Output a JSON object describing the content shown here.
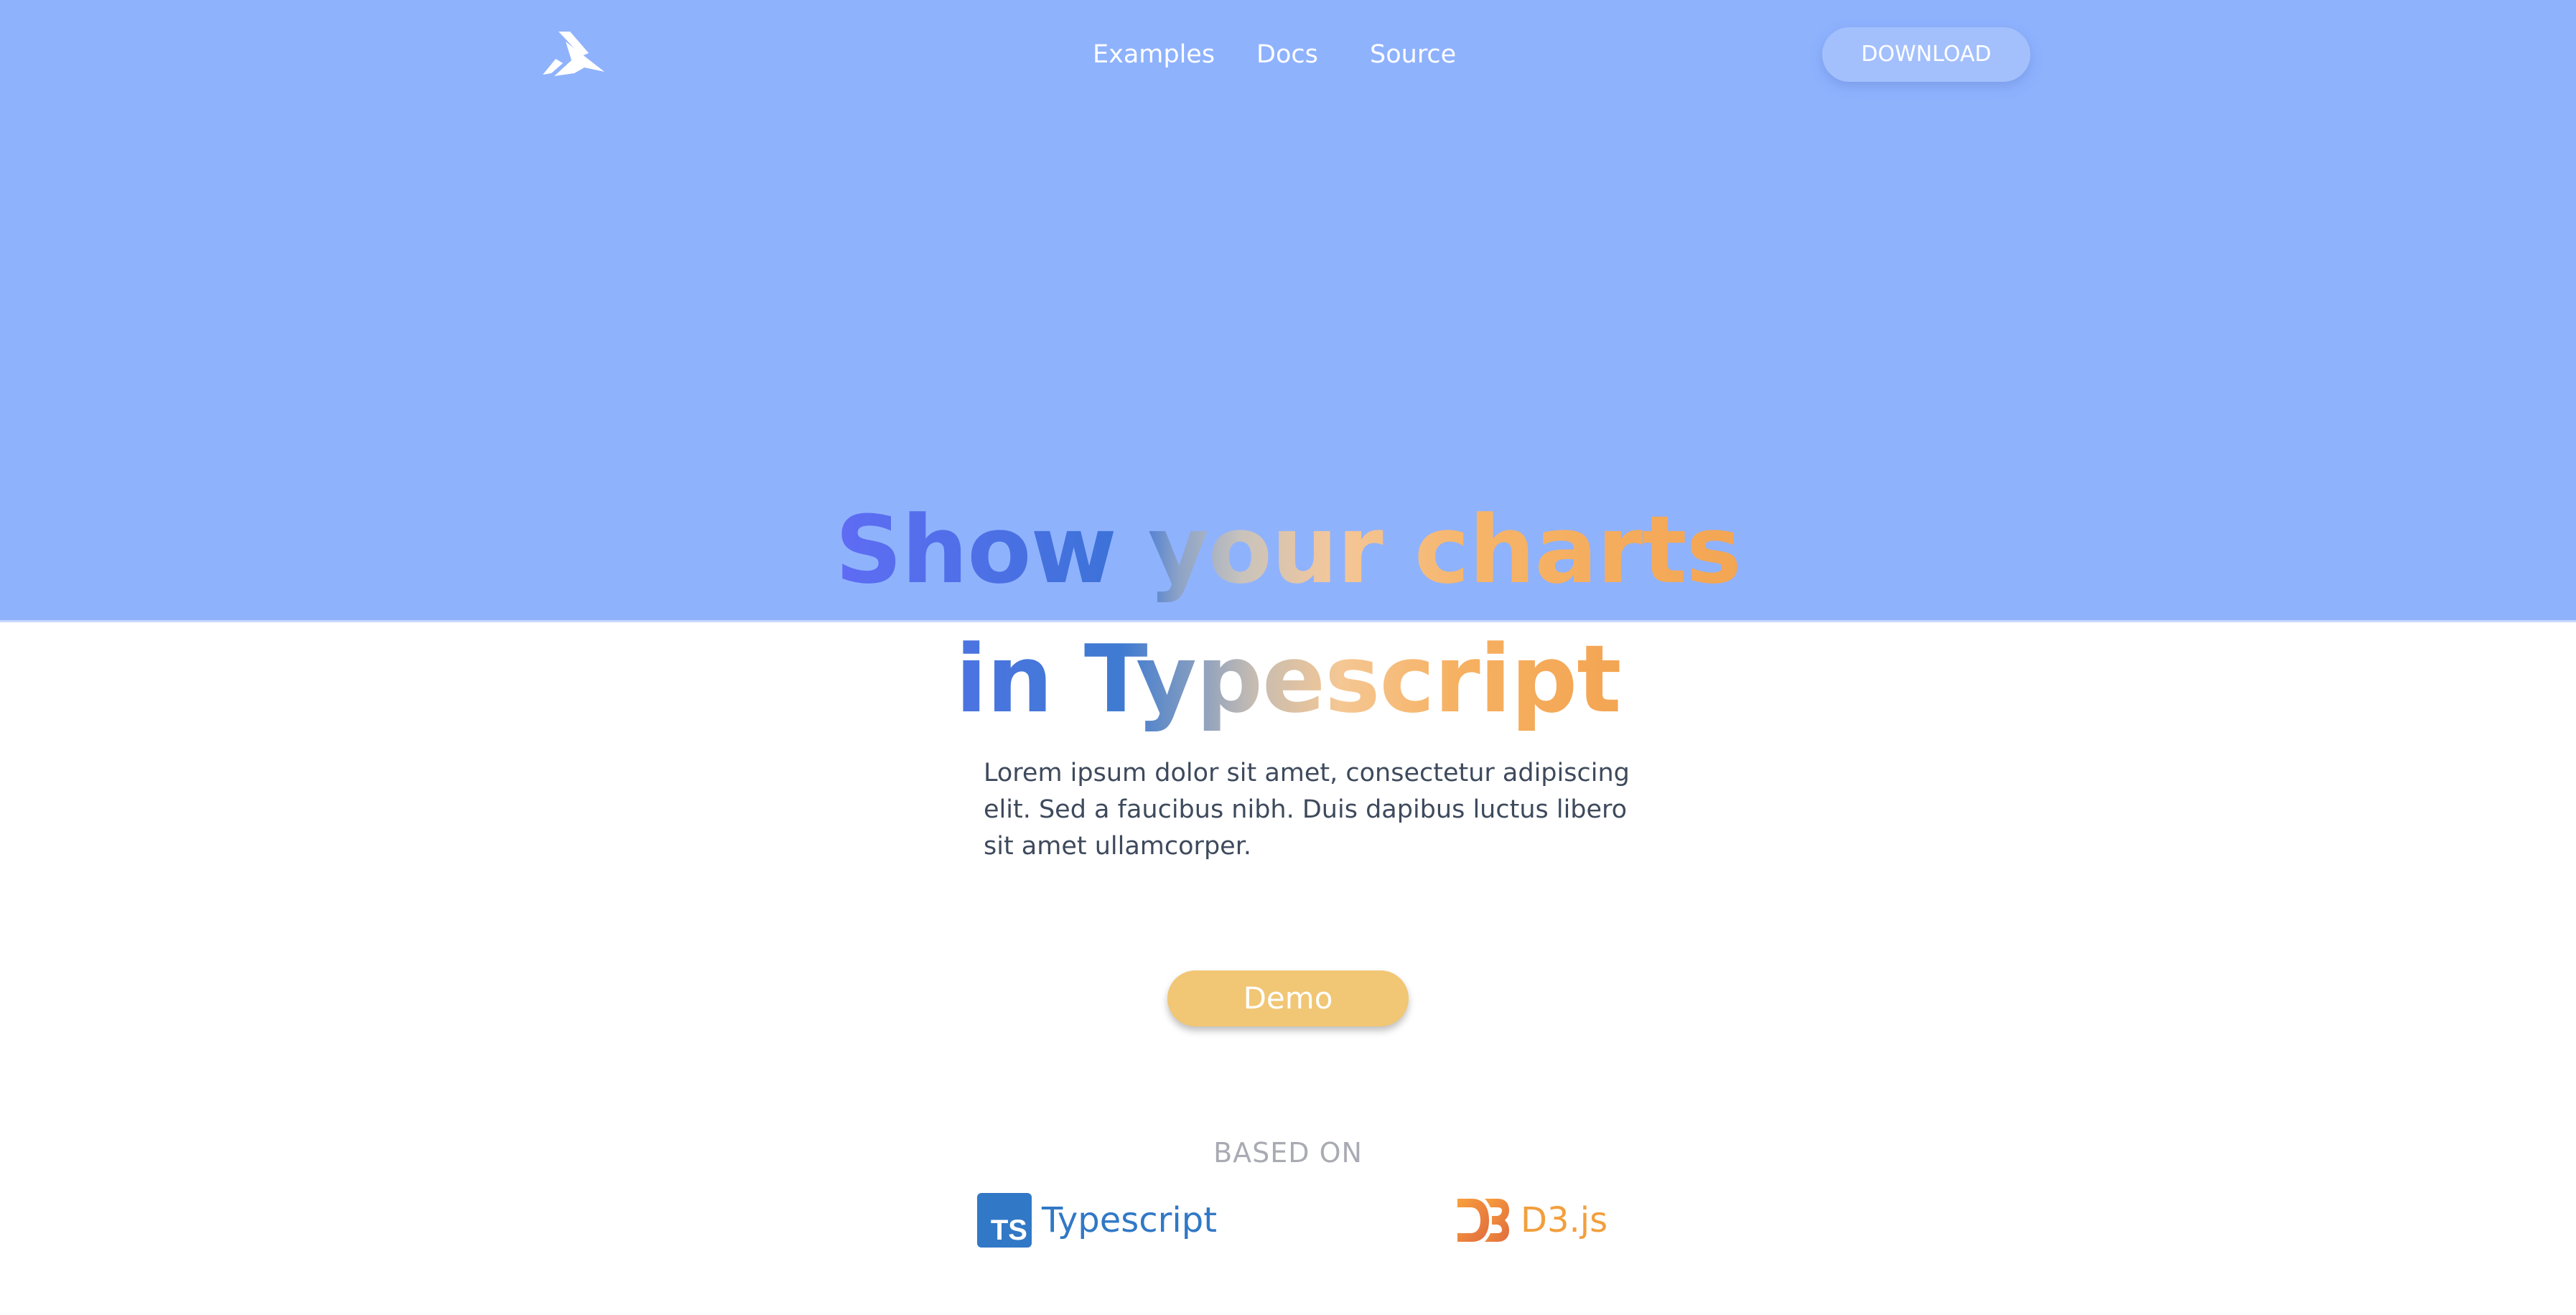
{
  "nav": {
    "logo": "logo-icon",
    "links": [
      "Examples",
      "Docs",
      "Source"
    ],
    "download_label": "DOWNLOAD"
  },
  "hero": {
    "headline_line1": "Show your charts",
    "headline_line2": "in Typescript",
    "lead": "Lorem ipsum dolor sit amet, consectetur adipiscing elit. Sed a faucibus nibh. Duis dapibus luctus libero sit amet ullamcorper.",
    "demo_label": "Demo"
  },
  "based_on": {
    "heading": "BASED ON",
    "items": [
      {
        "label": "Typescript",
        "icon": "typescript-icon",
        "icon_text": "TS",
        "color": "#3178c6"
      },
      {
        "label": "D3.js",
        "icon": "d3-icon",
        "color": "#f29f3d"
      }
    ]
  },
  "colors": {
    "hero_background": "#8fb2fd",
    "demo_button": "#f1c674",
    "text": "#3e4a5c"
  }
}
